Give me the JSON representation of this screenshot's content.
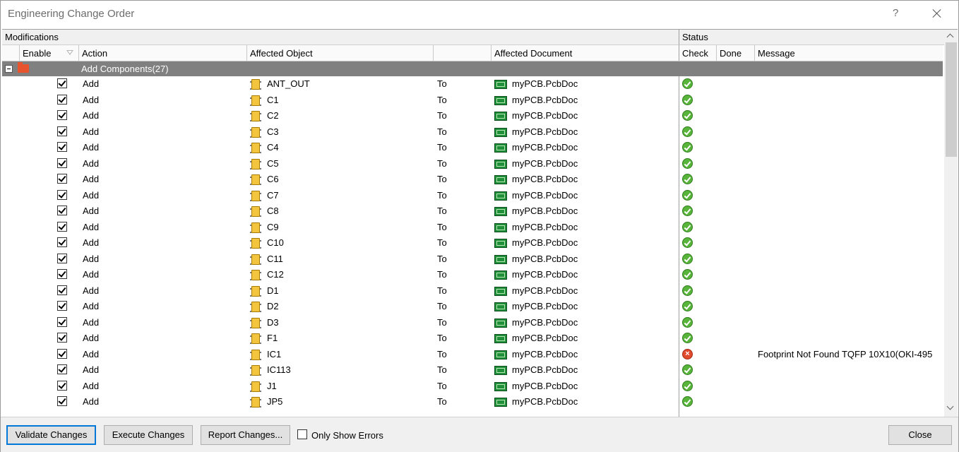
{
  "window": {
    "title": "Engineering Change Order",
    "help": "?"
  },
  "grid": {
    "group_headers": {
      "modifications": "Modifications",
      "status": "Status"
    },
    "columns": {
      "enable": "Enable",
      "action": "Action",
      "affected_object": "Affected Object",
      "blank": "",
      "affected_document": "Affected Document",
      "check": "Check",
      "done": "Done",
      "message": "Message"
    },
    "group": {
      "label": "Add Components(27)"
    },
    "rows": [
      {
        "action": "Add",
        "object": "ANT_OUT",
        "to": "To",
        "document": "myPCB.PcbDoc",
        "check": "ok",
        "message": ""
      },
      {
        "action": "Add",
        "object": "C1",
        "to": "To",
        "document": "myPCB.PcbDoc",
        "check": "ok",
        "message": ""
      },
      {
        "action": "Add",
        "object": "C2",
        "to": "To",
        "document": "myPCB.PcbDoc",
        "check": "ok",
        "message": ""
      },
      {
        "action": "Add",
        "object": "C3",
        "to": "To",
        "document": "myPCB.PcbDoc",
        "check": "ok",
        "message": ""
      },
      {
        "action": "Add",
        "object": "C4",
        "to": "To",
        "document": "myPCB.PcbDoc",
        "check": "ok",
        "message": ""
      },
      {
        "action": "Add",
        "object": "C5",
        "to": "To",
        "document": "myPCB.PcbDoc",
        "check": "ok",
        "message": ""
      },
      {
        "action": "Add",
        "object": "C6",
        "to": "To",
        "document": "myPCB.PcbDoc",
        "check": "ok",
        "message": ""
      },
      {
        "action": "Add",
        "object": "C7",
        "to": "To",
        "document": "myPCB.PcbDoc",
        "check": "ok",
        "message": ""
      },
      {
        "action": "Add",
        "object": "C8",
        "to": "To",
        "document": "myPCB.PcbDoc",
        "check": "ok",
        "message": ""
      },
      {
        "action": "Add",
        "object": "C9",
        "to": "To",
        "document": "myPCB.PcbDoc",
        "check": "ok",
        "message": ""
      },
      {
        "action": "Add",
        "object": "C10",
        "to": "To",
        "document": "myPCB.PcbDoc",
        "check": "ok",
        "message": ""
      },
      {
        "action": "Add",
        "object": "C11",
        "to": "To",
        "document": "myPCB.PcbDoc",
        "check": "ok",
        "message": ""
      },
      {
        "action": "Add",
        "object": "C12",
        "to": "To",
        "document": "myPCB.PcbDoc",
        "check": "ok",
        "message": ""
      },
      {
        "action": "Add",
        "object": "D1",
        "to": "To",
        "document": "myPCB.PcbDoc",
        "check": "ok",
        "message": ""
      },
      {
        "action": "Add",
        "object": "D2",
        "to": "To",
        "document": "myPCB.PcbDoc",
        "check": "ok",
        "message": ""
      },
      {
        "action": "Add",
        "object": "D3",
        "to": "To",
        "document": "myPCB.PcbDoc",
        "check": "ok",
        "message": ""
      },
      {
        "action": "Add",
        "object": "F1",
        "to": "To",
        "document": "myPCB.PcbDoc",
        "check": "ok",
        "message": ""
      },
      {
        "action": "Add",
        "object": "IC1",
        "to": "To",
        "document": "myPCB.PcbDoc",
        "check": "error",
        "message": "Footprint Not Found TQFP 10X10(OKI-495"
      },
      {
        "action": "Add",
        "object": "IC113",
        "to": "To",
        "document": "myPCB.PcbDoc",
        "check": "ok",
        "message": ""
      },
      {
        "action": "Add",
        "object": "J1",
        "to": "To",
        "document": "myPCB.PcbDoc",
        "check": "ok",
        "message": ""
      },
      {
        "action": "Add",
        "object": "JP5",
        "to": "To",
        "document": "myPCB.PcbDoc",
        "check": "ok",
        "message": ""
      }
    ]
  },
  "footer": {
    "validate": "Validate Changes",
    "execute": "Execute Changes",
    "report": "Report Changes...",
    "only_errors": "Only Show Errors",
    "close": "Close"
  }
}
